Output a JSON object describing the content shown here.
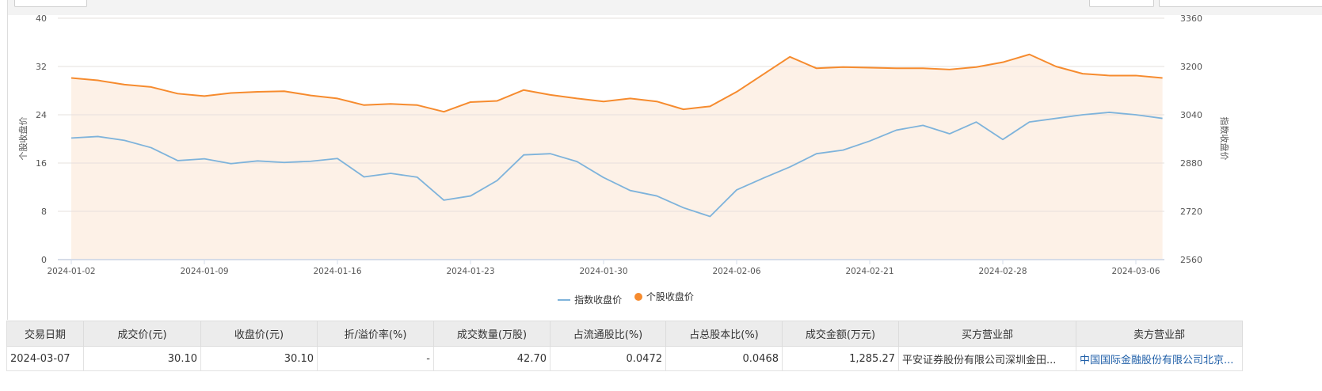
{
  "chart_data": {
    "type": "line",
    "left_axis": {
      "label": "个股收盘价",
      "range": [
        0,
        40
      ],
      "ticks": [
        0,
        8,
        16,
        24,
        32,
        40
      ]
    },
    "right_axis": {
      "label": "指数收盘价",
      "range": [
        2560,
        3360
      ],
      "ticks": [
        2560,
        2720,
        2880,
        3040,
        3200,
        3360
      ]
    },
    "x": [
      "2024-01-02",
      "2024-01-03",
      "2024-01-04",
      "2024-01-05",
      "2024-01-08",
      "2024-01-09",
      "2024-01-10",
      "2024-01-11",
      "2024-01-12",
      "2024-01-15",
      "2024-01-16",
      "2024-01-17",
      "2024-01-18",
      "2024-01-19",
      "2024-01-22",
      "2024-01-23",
      "2024-01-24",
      "2024-01-25",
      "2024-01-26",
      "2024-01-29",
      "2024-01-30",
      "2024-01-31",
      "2024-02-01",
      "2024-02-02",
      "2024-02-05",
      "2024-02-06",
      "2024-02-07",
      "2024-02-08",
      "2024-02-19",
      "2024-02-20",
      "2024-02-21",
      "2024-02-22",
      "2024-02-23",
      "2024-02-26",
      "2024-02-27",
      "2024-02-28",
      "2024-02-29",
      "2024-03-01",
      "2024-03-04",
      "2024-03-05",
      "2024-03-06",
      "2024-03-07"
    ],
    "x_tick_labels": [
      "2024-01-02",
      "2024-01-09",
      "2024-01-16",
      "2024-01-23",
      "2024-01-30",
      "2024-02-06",
      "2024-02-21",
      "2024-02-28",
      "2024-03-06"
    ],
    "grid": true,
    "legend_position": "bottom",
    "series": [
      {
        "name": "指数收盘价",
        "axis": "right",
        "color": "#7eb3db",
        "area": false,
        "values": [
          2963,
          2968,
          2955,
          2931,
          2888,
          2894,
          2878,
          2887,
          2882,
          2886,
          2895,
          2834,
          2846,
          2833,
          2757,
          2771,
          2822,
          2907,
          2911,
          2885,
          2832,
          2789,
          2771,
          2732,
          2703,
          2791,
          2830,
          2867,
          2911,
          2923,
          2953,
          2989,
          3005,
          2977,
          3016,
          2958,
          3016,
          3028,
          3040,
          3048,
          3040,
          3028
        ]
      },
      {
        "name": "个股收盘价",
        "axis": "left",
        "color": "#f68b2e",
        "area": true,
        "area_color": "#fdf1e7",
        "values": [
          30.1,
          29.7,
          29.0,
          28.6,
          27.5,
          27.1,
          27.6,
          27.8,
          27.9,
          27.2,
          26.7,
          25.6,
          25.8,
          25.6,
          24.5,
          26.1,
          26.3,
          28.1,
          27.3,
          26.7,
          26.2,
          26.7,
          26.2,
          24.9,
          25.4,
          27.8,
          30.7,
          33.6,
          31.7,
          31.9,
          31.8,
          31.7,
          31.7,
          31.5,
          31.9,
          32.7,
          34.0,
          32.0,
          30.8,
          30.5,
          30.5,
          30.1
        ]
      }
    ]
  },
  "table": {
    "headers": [
      "交易日期",
      "成交价(元)",
      "收盘价(元)",
      "折/溢价率(%)",
      "成交数量(万股)",
      "占流通股比(%)",
      "占总股本比(%)",
      "成交金额(万元)",
      "买方营业部",
      "卖方营业部"
    ],
    "rows": [
      [
        "2024-03-07",
        "30.10",
        "30.10",
        "-",
        "42.70",
        "0.0472",
        "0.0468",
        "1,285.27",
        "平安证券股份有限公司深圳金田...",
        "中国国际金融股份有限公司北京..."
      ]
    ]
  }
}
